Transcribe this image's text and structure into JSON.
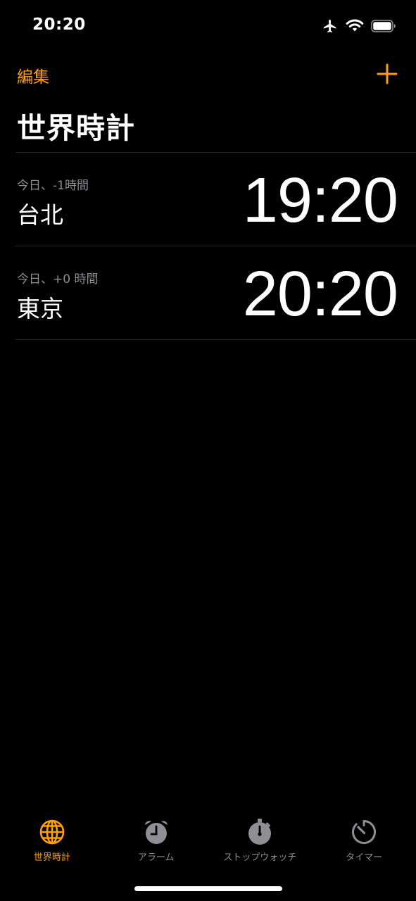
{
  "status_bar": {
    "time": "20:20",
    "icons": [
      "airplane-icon",
      "wifi-icon",
      "battery-icon"
    ]
  },
  "nav": {
    "edit_label": "編集",
    "add_icon": "plus-icon"
  },
  "title": "世界時計",
  "clocks": [
    {
      "offset": "今日、-1時間",
      "city": "台北",
      "time": "19:20"
    },
    {
      "offset": "今日、+0 時間",
      "city": "東京",
      "time": "20:20"
    }
  ],
  "tabs": [
    {
      "label": "世界時計",
      "icon": "globe-icon",
      "active": true
    },
    {
      "label": "アラーム",
      "icon": "alarm-clock-icon",
      "active": false
    },
    {
      "label": "ストップウォッチ",
      "icon": "stopwatch-icon",
      "active": false
    },
    {
      "label": "タイマー",
      "icon": "timer-icon",
      "active": false
    }
  ],
  "colors": {
    "accent": "#ff9f0a",
    "background": "#000000",
    "secondary_text": "#8e8e93",
    "inactive_icon": "#8e8e93"
  }
}
